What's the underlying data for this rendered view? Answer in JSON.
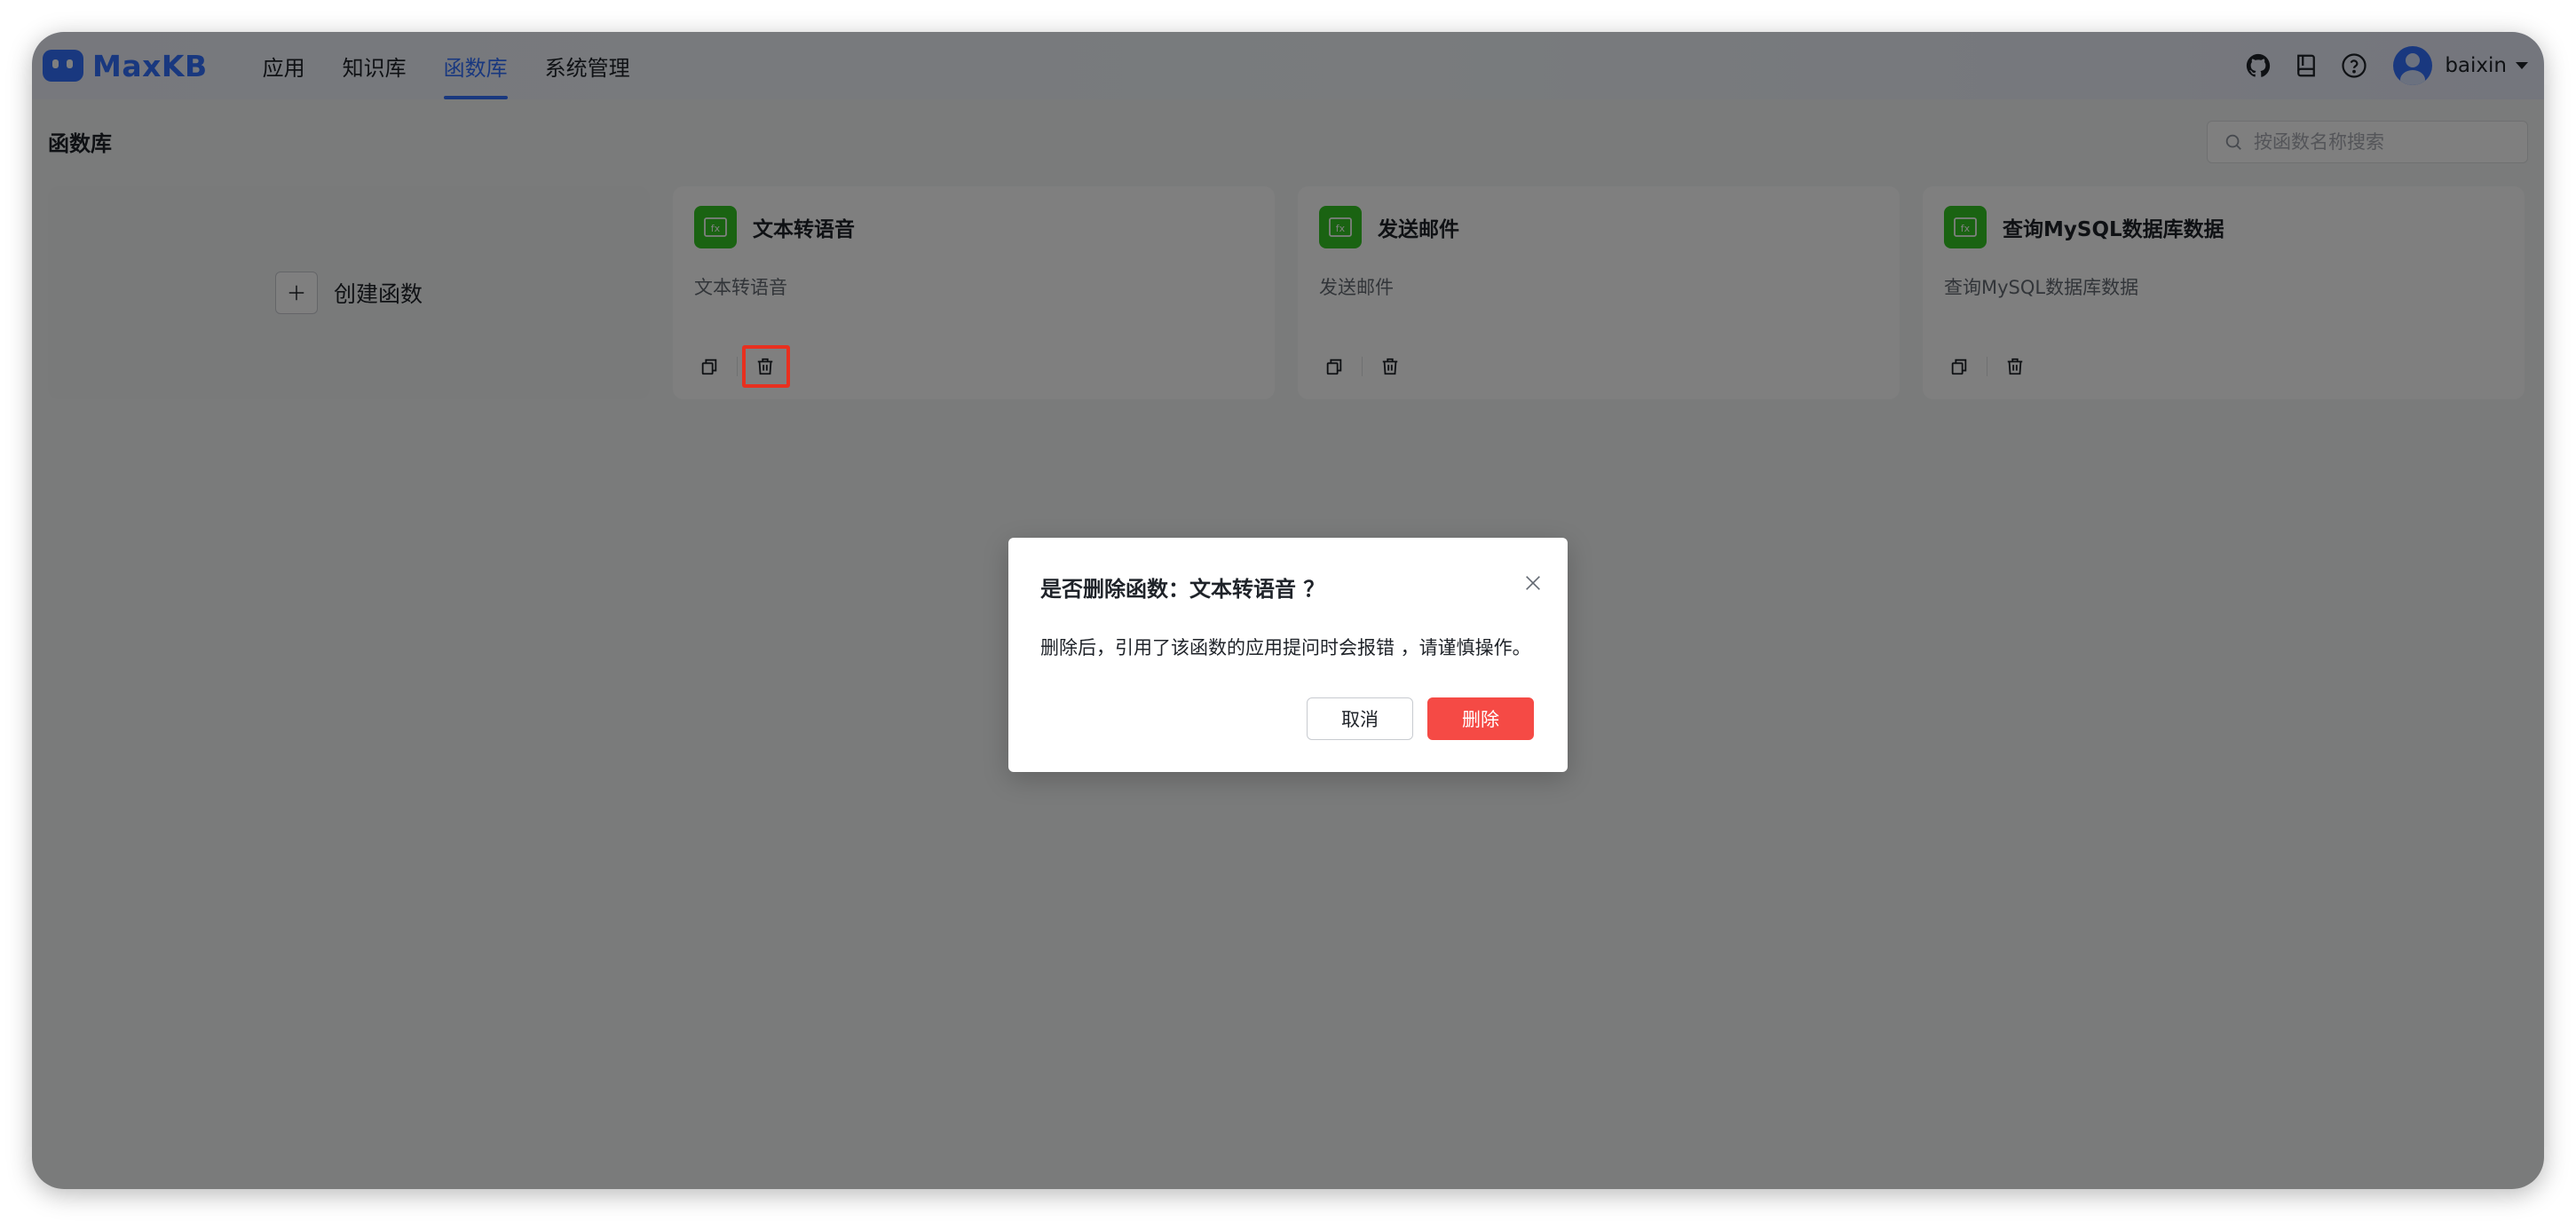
{
  "app": {
    "logo_text": "MaxKB",
    "brand_color": "#3370ff"
  },
  "nav": {
    "items": [
      {
        "label": "应用",
        "active": false
      },
      {
        "label": "知识库",
        "active": false
      },
      {
        "label": "函数库",
        "active": true
      },
      {
        "label": "系统管理",
        "active": false
      }
    ]
  },
  "header": {
    "icons": [
      "github-icon",
      "document-icon",
      "help-icon"
    ],
    "username": "baixin"
  },
  "page": {
    "title": "函数库",
    "search_placeholder": "按函数名称搜索"
  },
  "create_card": {
    "label": "创建函数"
  },
  "functions": [
    {
      "name": "文本转语音",
      "description": "文本转语音"
    },
    {
      "name": "发送邮件",
      "description": "发送邮件"
    },
    {
      "name": "查询MySQL数据库数据",
      "description": "查询MySQL数据库数据"
    }
  ],
  "dialog": {
    "title": "是否删除函数：文本转语音 ？",
    "message": "删除后，引用了该函数的应用提问时会报错 ，请谨慎操作。",
    "cancel_label": "取消",
    "confirm_label": "删除",
    "confirm_color": "#f54a45"
  }
}
